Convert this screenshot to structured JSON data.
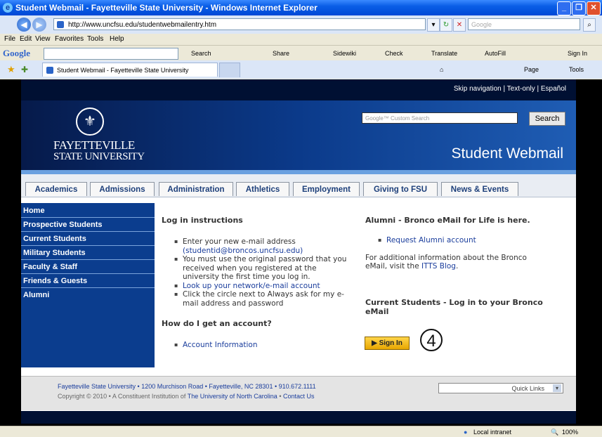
{
  "window": {
    "title": "Student Webmail - Fayetteville State University - Windows Internet Explorer"
  },
  "address": {
    "url": "http://www.uncfsu.edu/studentwebmailentry.htm",
    "search_placeholder": "Google"
  },
  "menu": [
    "File",
    "Edit",
    "View",
    "Favorites",
    "Tools",
    "Help"
  ],
  "google_toolbar": {
    "logo": "Google",
    "items": [
      "Search",
      "Share",
      "Sidewiki",
      "Check",
      "Translate",
      "AutoFill",
      "Sign In"
    ]
  },
  "tabs": {
    "active": "Student Webmail - Fayetteville State University",
    "cmd": [
      "Page",
      "Tools"
    ]
  },
  "site": {
    "skip_nav": "Skip navigation | Text-only | Español",
    "search_placeholder": "Google™ Custom Search",
    "search_button": "Search",
    "logo_line1": "FAYETTEVILLE",
    "logo_line2": "STATE UNIVERSITY",
    "page_title": "Student Webmail"
  },
  "nav_tabs": [
    "Academics",
    "Admissions",
    "Administration",
    "Athletics",
    "Employment",
    "Giving to FSU",
    "News & Events"
  ],
  "sidebar": [
    "Home",
    "Prospective Students",
    "Current Students",
    "Military Students",
    "Faculty & Staff",
    "Friends & Guests",
    "Alumni"
  ],
  "login": {
    "heading": "Log in instructions",
    "b1": "Enter your new e-mail address",
    "b1b": "(studentid@broncos.uncfsu.edu)",
    "b2": "You must use the original password that you received when you registered at the university the first time you log in.",
    "b3": "Look up your network/e-mail account",
    "b4": "Click the circle next to Always ask for my e-mail address and password",
    "account_heading": "How do I get an account?",
    "account_link": "Account Information"
  },
  "alumni": {
    "heading": "Alumni - Bronco eMail for Life is here.",
    "link": "Request Alumni account",
    "info": "For additional information about the Bronco eMail, visit the",
    "info_link": "ITTS Blog",
    "current_heading": "Current Students - Log in to your Bronco eMail",
    "signin": "Sign In",
    "step": "4"
  },
  "footer": {
    "line1": "Fayetteville State University • 1200 Murchison Road • Fayetteville, NC 28301 • 910.672.1111",
    "line2_pre": "Copyright © 2010 • A Constituent Institution of",
    "line2_link1": "The University of North Carolina",
    "line2_sep": "•",
    "line2_link2": "Contact Us",
    "quicklinks": "Quick Links"
  },
  "status": {
    "zone": "Local intranet",
    "zoom": "100%"
  }
}
